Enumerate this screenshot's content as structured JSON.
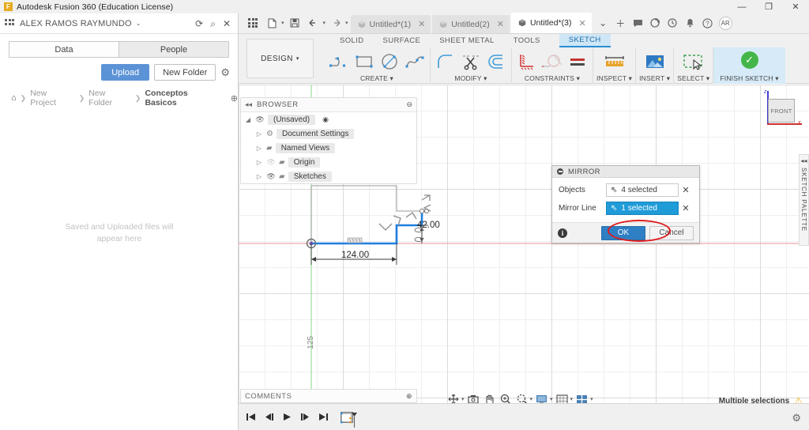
{
  "titlebar": {
    "app_title": "Autodesk Fusion 360 (Education License)",
    "logo_glyph": "F",
    "minimize": "—",
    "maximize": "❐",
    "close": "✕"
  },
  "data_panel": {
    "user_name": "ALEX RAMOS RAYMUNDO",
    "user_caret": "⌄",
    "refresh_icon": "⟳",
    "search_icon": "⌕",
    "close_icon": "✕",
    "tabs": [
      {
        "label": "Data",
        "active": true
      },
      {
        "label": "People",
        "active": false
      }
    ],
    "upload_label": "Upload",
    "new_folder_label": "New Folder",
    "settings_icon": "⚙",
    "breadcrumb": {
      "home_icon": "⌂",
      "separator": "❯",
      "items": [
        "New Project",
        "New Folder",
        "Conceptos Basicos"
      ],
      "globe_icon": "⊕"
    },
    "empty_message_line1": "Saved and Uploaded files will",
    "empty_message_line2": "appear here"
  },
  "quick_access": {
    "grid_icon": "grid-icon",
    "new_file_icon": "📄",
    "new_file_caret": "▾",
    "save_icon": "💾",
    "undo_icon": "↶",
    "undo_caret": "▾",
    "redo_icon": "↷",
    "redo_caret": "▾"
  },
  "document_tabs": [
    {
      "label": "Untitled*(1)",
      "active": false,
      "close": "✕"
    },
    {
      "label": "Untitled(2)",
      "active": false,
      "close": "✕"
    },
    {
      "label": "Untitled*(3)",
      "active": true,
      "close": "✕"
    }
  ],
  "tabs_right": {
    "overflow_caret": "⌄",
    "add_tab": "＋",
    "comment_icon": "🗨",
    "refresh_icon": "◔",
    "job_status_icon": "◕",
    "notification_icon": "🔔",
    "help_icon": "?",
    "avatar_initials": "AR"
  },
  "ribbon": {
    "workspace_label": "DESIGN",
    "workspace_caret": "▾",
    "tabs": [
      {
        "label": "SOLID",
        "active": false
      },
      {
        "label": "SURFACE",
        "active": false
      },
      {
        "label": "SHEET METAL",
        "active": false
      },
      {
        "label": "TOOLS",
        "active": false
      },
      {
        "label": "SKETCH",
        "active": true
      }
    ],
    "groups": [
      {
        "label": "CREATE ▾",
        "items": [
          "line-icon",
          "rectangle-icon",
          "circle-icon",
          "spline-icon"
        ]
      },
      {
        "label": "MODIFY ▾",
        "items": [
          "fillet-icon",
          "trim-scissors-icon",
          "offset-icon"
        ]
      },
      {
        "label": "CONSTRAINTS ▾",
        "items": [
          "vertical-horizontal-icon",
          "tangent-icon",
          "equal-icon"
        ]
      },
      {
        "label": "INSPECT ▾",
        "items": [
          "measure-icon"
        ]
      },
      {
        "label": "INSERT ▾",
        "items": [
          "insert-image-icon"
        ]
      },
      {
        "label": "SELECT ▾",
        "items": [
          "select-window-icon"
        ]
      }
    ],
    "finish_sketch_label": "FINISH SKETCH ▾",
    "finish_sketch_check": "✓"
  },
  "browser": {
    "collapse_icon": "◂◂",
    "title": "BROWSER",
    "dot_icon": "⊖",
    "nodes": [
      {
        "arrow": "◢",
        "eye": "👁",
        "label": "(Unsaved)",
        "target": "◉",
        "eye_off": false,
        "indent": 0
      },
      {
        "arrow": "▷",
        "eye": "",
        "icon": "⚙",
        "label": "Document Settings",
        "eye_off": false,
        "indent": 1
      },
      {
        "arrow": "▷",
        "eye": "",
        "icon": "▰",
        "label": "Named Views",
        "eye_off": false,
        "indent": 1
      },
      {
        "arrow": "▷",
        "eye": "👁",
        "icon": "▰",
        "label": "Origin",
        "eye_off": true,
        "indent": 1
      },
      {
        "arrow": "▷",
        "eye": "👁",
        "icon": "▰",
        "label": "Sketches",
        "eye_off": false,
        "indent": 1
      }
    ]
  },
  "comments": {
    "label": "COMMENTS",
    "dot_icon": "⊕"
  },
  "navbar": {
    "items": [
      {
        "name": "orbit-icon",
        "glyph": "✛",
        "caret": "▾"
      },
      {
        "name": "look-at-icon",
        "glyph": "⌷",
        "caret": ""
      },
      {
        "name": "pan-hand-icon",
        "glyph": "✋",
        "caret": ""
      },
      {
        "name": "zoom-icon",
        "glyph": "⌕",
        "caret": ""
      },
      {
        "name": "fit-icon",
        "glyph": "⌕",
        "caret": "▾"
      },
      {
        "name": "display-settings-icon",
        "glyph": "🖥",
        "caret": "▾"
      },
      {
        "name": "grid-snaps-icon",
        "glyph": "▦",
        "caret": "▾"
      },
      {
        "name": "viewports-icon",
        "glyph": "⊞",
        "caret": "▾"
      }
    ]
  },
  "status_bar": {
    "message": "Multiple selections",
    "warning_icon": "⚠"
  },
  "viewcube": {
    "face_label": "FRONT",
    "z_label": "z",
    "x_label": "x"
  },
  "sketch_palette": {
    "collapse_icon": "◂◂",
    "label": "SKETCH PALETTE"
  },
  "mirror_dialog": {
    "title": "MIRROR",
    "minimize_icon": "⊖",
    "rows": [
      {
        "label": "Objects",
        "value": "4 selected",
        "cursor": "⇖",
        "clear": "✕",
        "active": false
      },
      {
        "label": "Mirror Line",
        "value": "1 selected",
        "cursor": "⇖",
        "clear": "✕",
        "active": true
      }
    ],
    "info_icon": "i",
    "ok_label": "OK",
    "cancel_label": "Cancel",
    "highlight_color": "#e01b1b",
    "accent_color": "#1f9bd8"
  },
  "sketch": {
    "dimension_horizontal": "124.00",
    "dimension_vertical": "42.00",
    "axis_label_vertical": "125",
    "sketch_color": "#1f7fe0",
    "construction_color": "#8c8c8c",
    "x_axis_color": "#e8a0a0",
    "y_axis_color": "#8fdc8f"
  },
  "timeline": {
    "buttons": [
      "⏮",
      "◀|",
      "▶",
      "|▶",
      "⏭"
    ],
    "feature_name": "sketch-feature-icon",
    "settings_icon": "⚙"
  }
}
